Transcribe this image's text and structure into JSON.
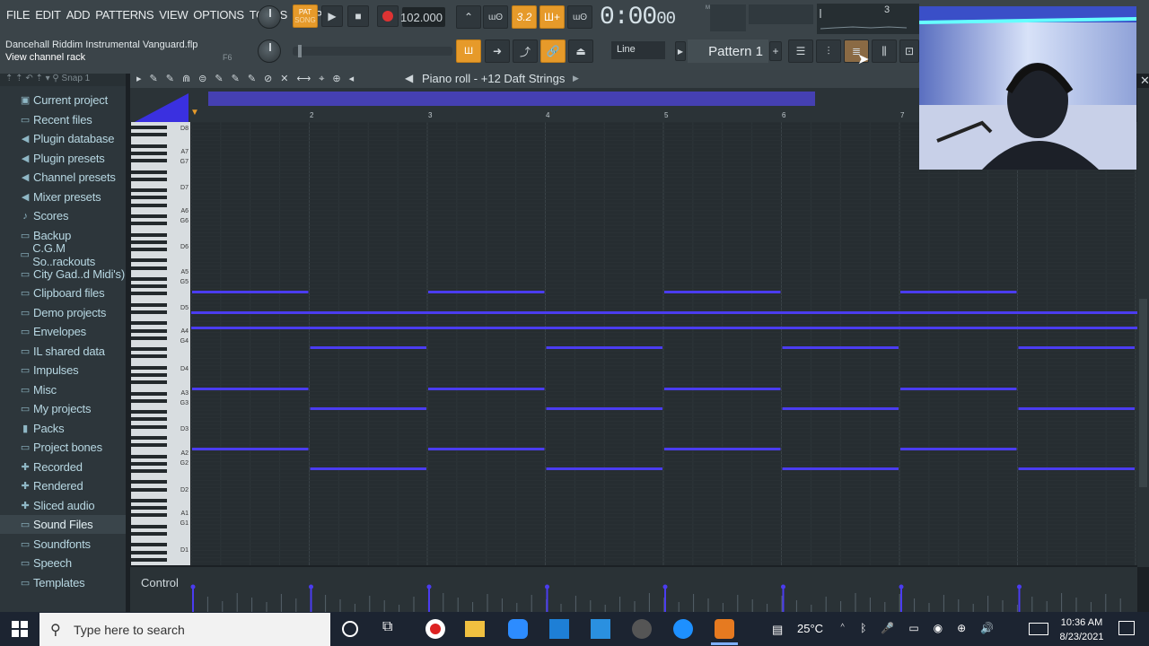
{
  "menu": [
    "FILE",
    "EDIT",
    "ADD",
    "PATTERNS",
    "VIEW",
    "OPTIONS",
    "TOOLS",
    "HELP"
  ],
  "transport": {
    "pat_label": "PAT",
    "song_label": "SONG",
    "tempo": "102.000",
    "time_main": "0:00",
    "time_frac": "00",
    "time_unit": "M:S:CS",
    "step_value": "3.2"
  },
  "file": {
    "name": "Dancehall Riddim Instrumental Vanguard.flp",
    "hint": "View channel rack",
    "hint_key": "F6"
  },
  "toolbar": {
    "snap_mode": "Line",
    "pattern": "Pattern 1",
    "cpu_value": "3"
  },
  "browser": {
    "snap_label": "Snap 1",
    "items": [
      {
        "label": "Current project",
        "icon": "folder-special-icon"
      },
      {
        "label": "Recent files",
        "icon": "folder-icon"
      },
      {
        "label": "Plugin database",
        "icon": "plug-icon"
      },
      {
        "label": "Plugin presets",
        "icon": "plug-icon"
      },
      {
        "label": "Channel presets",
        "icon": "plug-icon"
      },
      {
        "label": "Mixer presets",
        "icon": "plug-icon"
      },
      {
        "label": "Scores",
        "icon": "note-icon"
      },
      {
        "label": "Backup",
        "icon": "folder-icon"
      },
      {
        "label": "C.G.M So..rackouts",
        "icon": "folder-icon"
      },
      {
        "label": "City Gad..d Midi's)",
        "icon": "folder-icon"
      },
      {
        "label": "Clipboard files",
        "icon": "folder-icon"
      },
      {
        "label": "Demo projects",
        "icon": "folder-icon"
      },
      {
        "label": "Envelopes",
        "icon": "folder-icon"
      },
      {
        "label": "IL shared data",
        "icon": "folder-icon"
      },
      {
        "label": "Impulses",
        "icon": "folder-icon"
      },
      {
        "label": "Misc",
        "icon": "folder-icon"
      },
      {
        "label": "My projects",
        "icon": "folder-icon"
      },
      {
        "label": "Packs",
        "icon": "pack-icon"
      },
      {
        "label": "Project bones",
        "icon": "folder-icon"
      },
      {
        "label": "Recorded",
        "icon": "plus-icon"
      },
      {
        "label": "Rendered",
        "icon": "plus-icon"
      },
      {
        "label": "Sliced audio",
        "icon": "plus-icon"
      },
      {
        "label": "Sound Files",
        "icon": "folder-icon"
      },
      {
        "label": "Soundfonts",
        "icon": "folder-icon"
      },
      {
        "label": "Speech",
        "icon": "folder-icon"
      },
      {
        "label": "Templates",
        "icon": "folder-icon"
      }
    ],
    "selected": "Sound Files"
  },
  "piano_roll": {
    "title": "Piano roll - +12 Daft Strings",
    "bars": [
      "2",
      "3",
      "4",
      "5",
      "6",
      "7"
    ],
    "octave_labels": [
      "D8",
      "A7",
      "G7",
      "D7",
      "A6",
      "G6",
      "D6",
      "A5",
      "G5",
      "D5",
      "A4",
      "G4",
      "D4",
      "A3",
      "G3",
      "D3",
      "A2",
      "G2",
      "D2",
      "A1",
      "G1",
      "D1"
    ],
    "note_color": "#4b3cf0",
    "control_label": "Control"
  },
  "taskbar": {
    "search_placeholder": "Type here to search",
    "temperature": "25°C",
    "time": "10:36 AM",
    "date": "8/23/2021"
  }
}
